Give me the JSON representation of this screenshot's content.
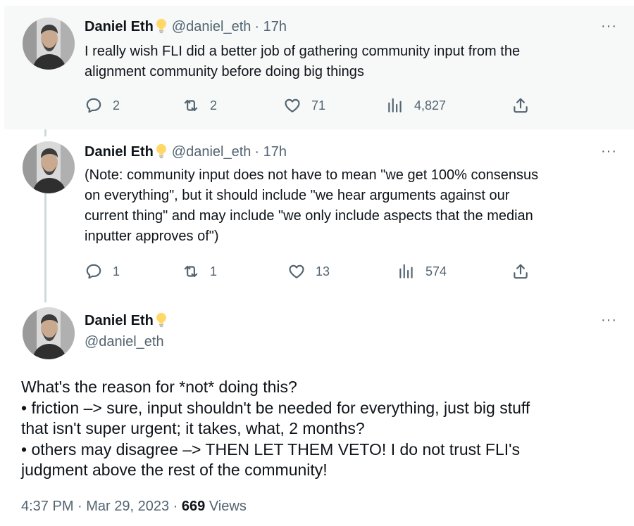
{
  "tweets": [
    {
      "author": "Daniel Eth",
      "handle": "@daniel_eth",
      "time": "· 17h",
      "text_lines": [
        "I really wish FLI did a better job of gathering community input from the",
        "alignment community before doing big things"
      ],
      "replies": "2",
      "retweets": "2",
      "likes": "71",
      "views": "4,827"
    },
    {
      "author": "Daniel Eth",
      "handle": "@daniel_eth",
      "time": "· 17h",
      "text_lines": [
        "(Note: community input does not have to mean \"we get 100% consensus",
        "on everything\", but it should include \"we hear arguments against our",
        "current thing\" and may include \"we only include aspects that the median",
        "inputter approves of\")"
      ],
      "replies": "1",
      "retweets": "1",
      "likes": "13",
      "views": "574"
    }
  ],
  "main_tweet": {
    "author": "Daniel Eth",
    "handle": "@daniel_eth",
    "text_lines": [
      "What's the reason for *not* doing this?",
      "• friction –> sure, input shouldn't be needed for everything, just big stuff",
      "that isn't super urgent; it takes, what, 2 months?",
      "• others may disagree –> THEN LET THEM VETO! I do not trust FLI's",
      "judgment above the rest of the community!"
    ],
    "timestamp": "4:37 PM · Mar 29, 2023 ·",
    "views_count": "669",
    "views_label": "Views"
  },
  "more_label": "···",
  "icons": [
    "reply-icon",
    "retweet-icon",
    "like-icon",
    "views-icon",
    "share-icon",
    "lightbulb-icon",
    "more-icon"
  ],
  "colors": {
    "text": "#0f1419",
    "secondary": "#536471",
    "thread_line": "#cfd9de",
    "highlight_bg": "#f7f9f9",
    "bulb": "#ffd866"
  }
}
